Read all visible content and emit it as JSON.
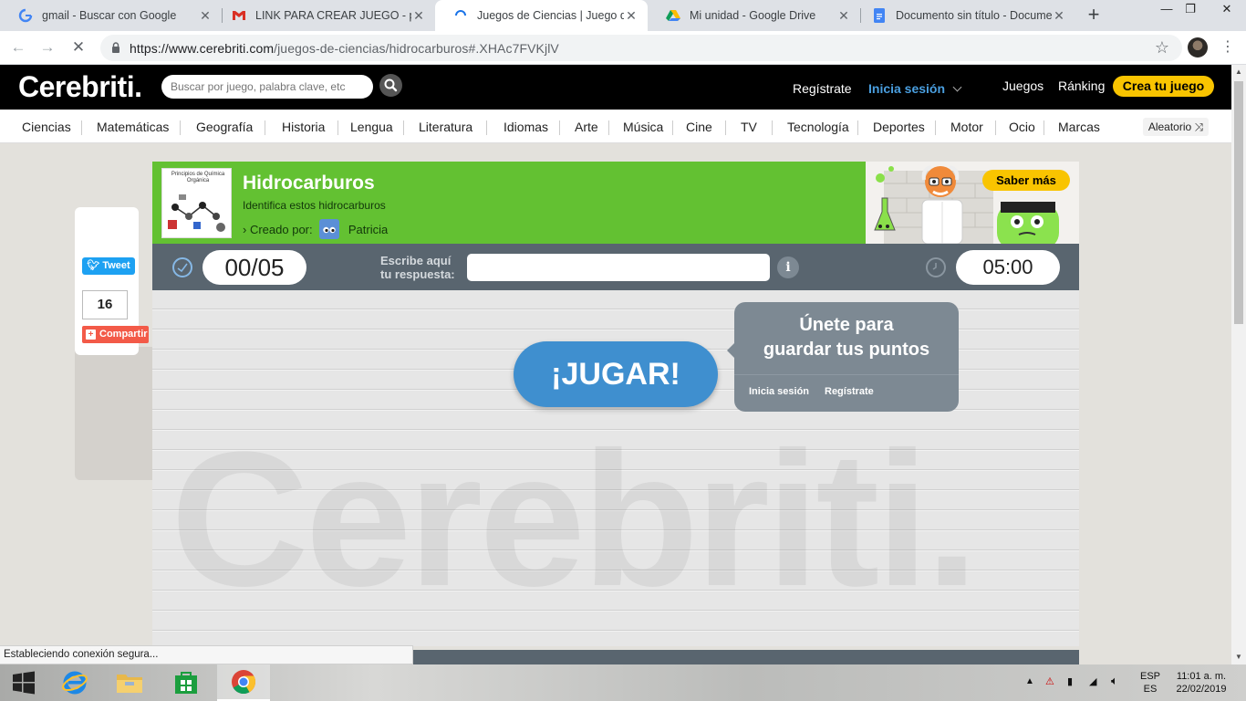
{
  "browser": {
    "tabs": [
      {
        "title": "gmail - Buscar con Google",
        "icon": "google-icon"
      },
      {
        "title": "LINK PARA CREAR JUEGO - pendiente",
        "icon": "gmail-icon"
      },
      {
        "title": "Juegos de Ciencias | Juego de Hidrocarburos",
        "icon": "loading-icon"
      },
      {
        "title": "Mi unidad - Google Drive",
        "icon": "drive-icon"
      },
      {
        "title": "Documento sin título - Documentos de Google",
        "icon": "docs-icon"
      }
    ],
    "url_host": "https://www.cerebriti.com",
    "url_path": "/juegos-de-ciencias/hidrocarburos#.XHAc7FVKjlV"
  },
  "header": {
    "logo": "Cerebriti.",
    "search_placeholder": "Buscar por juego, palabra clave, etc",
    "register": "Regístrate",
    "login": "Inicia sesión",
    "games": "Juegos",
    "ranking": "Ránking",
    "create": "Crea tu juego"
  },
  "categories": [
    "Ciencias",
    "Matemáticas",
    "Geografía",
    "Historia",
    "Lengua",
    "Literatura",
    "Idiomas",
    "Arte",
    "Música",
    "Cine",
    "TV",
    "Tecnología",
    "Deportes",
    "Motor",
    "Ocio",
    "Marcas"
  ],
  "random_label": "Aleatorio",
  "share": {
    "tweet": "Tweet",
    "count": "16",
    "share": "Compartir"
  },
  "game": {
    "thumb_title": "Principios de Química Orgánica",
    "title": "Hidrocarburos",
    "subtitle": "Identifica estos hidrocarburos",
    "created_by": "Creado por:",
    "author": "Patricia",
    "promo_button": "Saber más",
    "score": "00/05",
    "answer_label_1": "Escribe aquí",
    "answer_label_2": "tu respuesta:",
    "timer": "05:00",
    "play": "¡JUGAR!",
    "join_line1": "Únete para",
    "join_line2": "guardar tus puntos",
    "join_login": "Inicia sesión",
    "join_register": "Regístrate",
    "watermark": "Cerebriti."
  },
  "status": "Estableciendo conexión segura...",
  "taskbar": {
    "lang_top": "ESP",
    "lang_bottom": "ES",
    "time": "11:01 a. m.",
    "date": "22/02/2019"
  },
  "colors": {
    "brand_green": "#63c132",
    "brand_yellow": "#f9c400",
    "play_blue": "#3f8fcf",
    "bar_gray": "#59656f"
  }
}
